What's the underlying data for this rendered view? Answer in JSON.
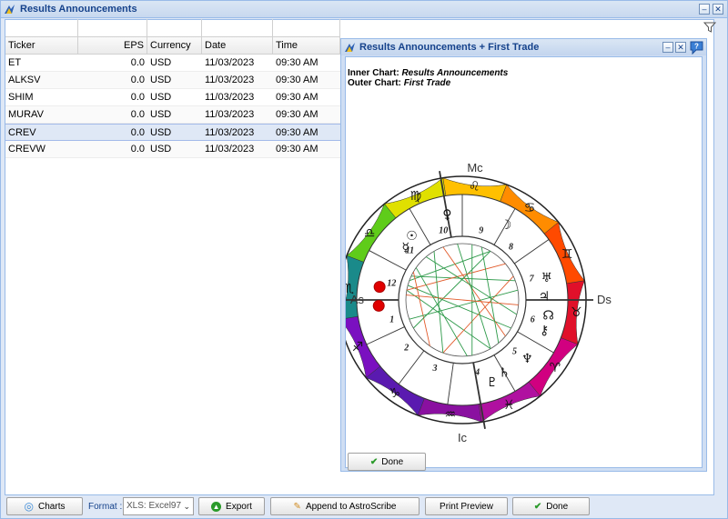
{
  "window": {
    "title": "Results Announcements"
  },
  "grid": {
    "columns": {
      "ticker": "Ticker",
      "eps": "EPS",
      "currency": "Currency",
      "date": "Date",
      "time": "Time"
    },
    "rows": [
      {
        "ticker": "ET",
        "eps": "0.0",
        "currency": "USD",
        "date": "11/03/2023",
        "time": "09:30 AM"
      },
      {
        "ticker": "ALKSV",
        "eps": "0.0",
        "currency": "USD",
        "date": "11/03/2023",
        "time": "09:30 AM"
      },
      {
        "ticker": "SHIM",
        "eps": "0.0",
        "currency": "USD",
        "date": "11/03/2023",
        "time": "09:30 AM"
      },
      {
        "ticker": "MURAV",
        "eps": "0.0",
        "currency": "USD",
        "date": "11/03/2023",
        "time": "09:30 AM"
      },
      {
        "ticker": "CREV",
        "eps": "0.0",
        "currency": "USD",
        "date": "11/03/2023",
        "time": "09:30 AM"
      },
      {
        "ticker": "CREVW",
        "eps": "0.0",
        "currency": "USD",
        "date": "11/03/2023",
        "time": "09:30 AM"
      }
    ],
    "selected_index": 4
  },
  "chart_window": {
    "title": "Results Announcements + First Trade",
    "inner_label": "Inner Chart:",
    "inner_value": "Results Announcements",
    "outer_label": "Outer Chart:",
    "outer_value": "First Trade",
    "done_label": "Done"
  },
  "wheel": {
    "angle_labels": {
      "mc": "Mc",
      "ic": "Ic",
      "as": "As",
      "ds": "Ds"
    },
    "houses": [
      "1",
      "2",
      "3",
      "4",
      "5",
      "6",
      "7",
      "8",
      "9",
      "10",
      "11",
      "12"
    ],
    "zodiac_glyphs": [
      "♈",
      "♉",
      "♊",
      "♋",
      "♌",
      "♍",
      "♎",
      "♏",
      "♐",
      "♑",
      "♒",
      "♓"
    ],
    "planet_glyphs": [
      "♀",
      "☉",
      "☿",
      "☽",
      "♅",
      "♃",
      "♄",
      "♆",
      "⚷",
      "☊",
      "♇"
    ]
  },
  "toolbar": {
    "charts_label": "Charts",
    "format_label": "Format :",
    "format_value": "XLS: Excel97",
    "export_label": "Export",
    "append_label": "Append to AstroScribe",
    "print_label": "Print Preview",
    "done_label": "Done"
  },
  "colors": {
    "accent": "#15428b",
    "border": "#99bbe8",
    "selected_row": "#dfe8f6"
  }
}
